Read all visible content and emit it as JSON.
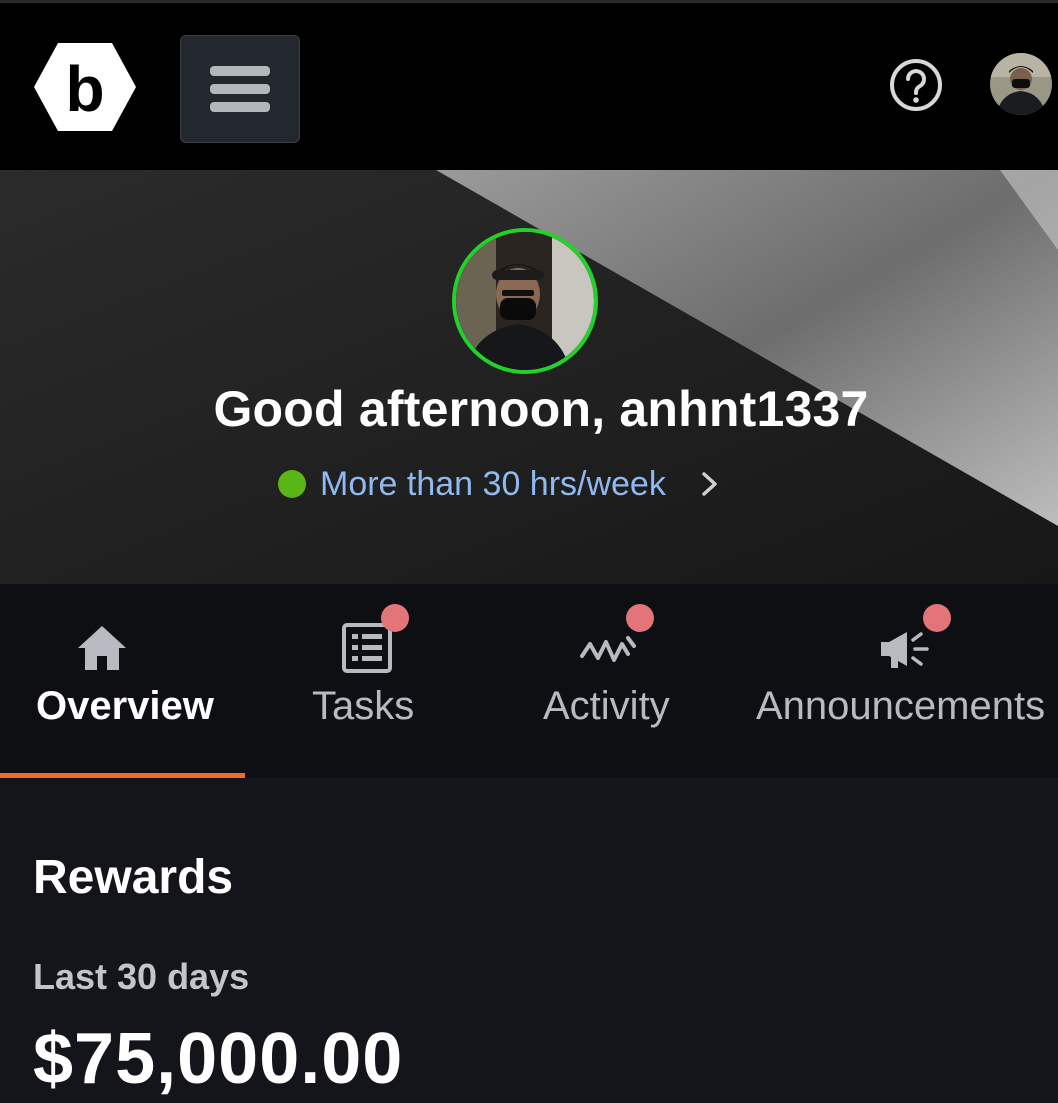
{
  "header": {
    "logo_letter": "b",
    "menu_icon": "hamburger-menu-icon",
    "help_icon": "help-circle-icon",
    "avatar": "user-avatar"
  },
  "hero": {
    "greeting": "Good afternoon, anhnt1337",
    "availability": "More than 30 hrs/week",
    "availability_color": "#5ab516",
    "ring_color": "#22d22a"
  },
  "tabs": [
    {
      "label": "Overview",
      "icon": "home-icon",
      "active": true,
      "badge": false
    },
    {
      "label": "Tasks",
      "icon": "list-icon",
      "active": false,
      "badge": true
    },
    {
      "label": "Activity",
      "icon": "activity-icon",
      "active": false,
      "badge": true
    },
    {
      "label": "Announcements",
      "icon": "megaphone-icon",
      "active": false,
      "badge": true
    }
  ],
  "rewards": {
    "title": "Rewards",
    "period": "Last 30 days",
    "amount": "$75,000.00"
  },
  "colors": {
    "accent": "#ec6b2d",
    "badge": "#e2747a",
    "link": "#8fb9f0"
  }
}
